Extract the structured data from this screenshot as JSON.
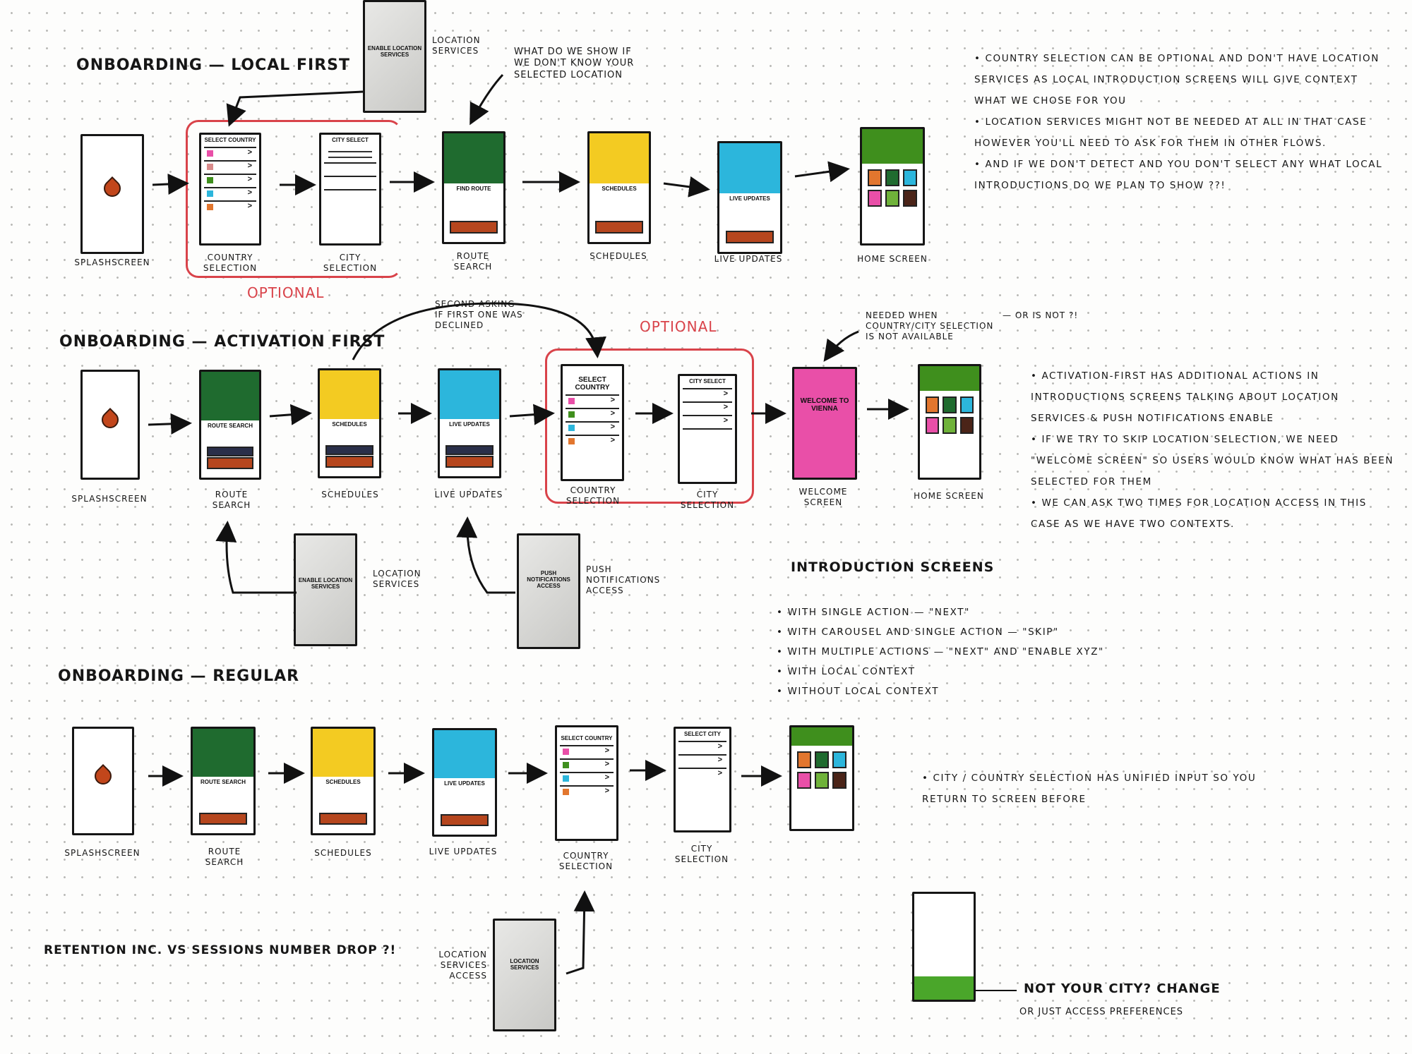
{
  "sections": [
    {
      "title": "Onboarding — local first",
      "screens": [
        {
          "label": "Splashscreen"
        },
        {
          "label": "Country selection",
          "header": "Select country"
        },
        {
          "label": "City selection",
          "header": "City select"
        },
        {
          "label": "Route search",
          "header": "Find route",
          "color": "#1f6b2f"
        },
        {
          "label": "Schedules",
          "header": "Schedules",
          "color": "#f3cb22"
        },
        {
          "label": "Live updates",
          "header": "Live updates",
          "color": "#2cb6dc"
        },
        {
          "label": "Home screen",
          "color": "#3f8f1d"
        }
      ],
      "optional_label": "Optional",
      "side_screen": {
        "text": "Enable location services",
        "label": "Location services"
      },
      "annotation": "What do we show if we don't know your selected location"
    },
    {
      "title": "Onboarding — activation first",
      "screens": [
        {
          "label": "Splashscreen"
        },
        {
          "label": "Route search",
          "header": "Route search",
          "color": "#1f6b2f"
        },
        {
          "label": "Schedules",
          "header": "Schedules",
          "color": "#f3cb22"
        },
        {
          "label": "Live updates",
          "header": "Live updates",
          "color": "#2cb6dc"
        },
        {
          "label": "Country selection",
          "header": "Select country"
        },
        {
          "label": "City selection",
          "header": "City select"
        },
        {
          "label": "Welcome screen",
          "header": "Welcome to Vienna",
          "color": "#e94fa8"
        },
        {
          "label": "Home screen",
          "color": "#3f8f1d"
        }
      ],
      "optional_label": "Optional",
      "second_asking": "Second asking if first one was declined",
      "welcome_note": "Needed when country/city selection is not available",
      "welcome_note_aside": "— or is not ?!",
      "side_screens": [
        {
          "text": "Enable location services",
          "label": "Location services"
        },
        {
          "text": "Push notifications access",
          "label": "Push notifications access"
        }
      ]
    },
    {
      "title": "Onboarding — regular",
      "screens": [
        {
          "label": "Splashscreen"
        },
        {
          "label": "Route search",
          "header": "Route search",
          "color": "#1f6b2f"
        },
        {
          "label": "Schedules",
          "header": "Schedules",
          "color": "#f3cb22"
        },
        {
          "label": "Live updates",
          "header": "Live updates",
          "color": "#2cb6dc"
        },
        {
          "label": "Country selection",
          "header": "Select country"
        },
        {
          "label": "City selection",
          "header": "Select city"
        },
        {
          "label": "Home screen",
          "color": "#3f8f1d"
        }
      ],
      "side_screen": {
        "text": "Location services",
        "label": "Location services access"
      }
    }
  ],
  "notes": {
    "local_first": [
      "Country selection can be optional and don't have location services as local introduction screens will give context what we chose for you",
      "Location services might not be needed at all in that case however you'll need to ask for them in other flows.",
      "And if we don't detect and you don't select any what local introductions do we plan to show ??!"
    ],
    "activation_first": [
      "Activation-first has additional actions in introductions screens talking about location services & push notifications enable",
      "If we try to skip location selection, we need \"welcome screen\" so users would know what has been selected for them",
      "We can ask two times for location access in this case as we have two contexts."
    ],
    "introduction_title": "Introduction screens",
    "introduction_items": [
      "With single action — \"Next\"",
      "With carousel and single action — \"Skip\"",
      "With multiple actions — \"Next\" and \"Enable xyz\"",
      "With local context",
      "Without local context"
    ],
    "regular": [
      "City / country selection has unified input so you return to screen before"
    ],
    "retention": "Retention inc. vs sessions number drop ?!",
    "banner_title": "Not your city?   Change",
    "banner_sub": "or just access preferences",
    "banner_color": "#4aa62a"
  },
  "colors": {
    "ink": "#151515",
    "optional_red": "#d9434a",
    "orange": "#e2762e",
    "dark_green": "#1f6b2f",
    "yellow": "#f3cb22",
    "blue": "#2cb6dc",
    "pink": "#e94fa8",
    "lime": "#6fb23a",
    "brown": "#4b2418",
    "rust": "#b6461e"
  }
}
